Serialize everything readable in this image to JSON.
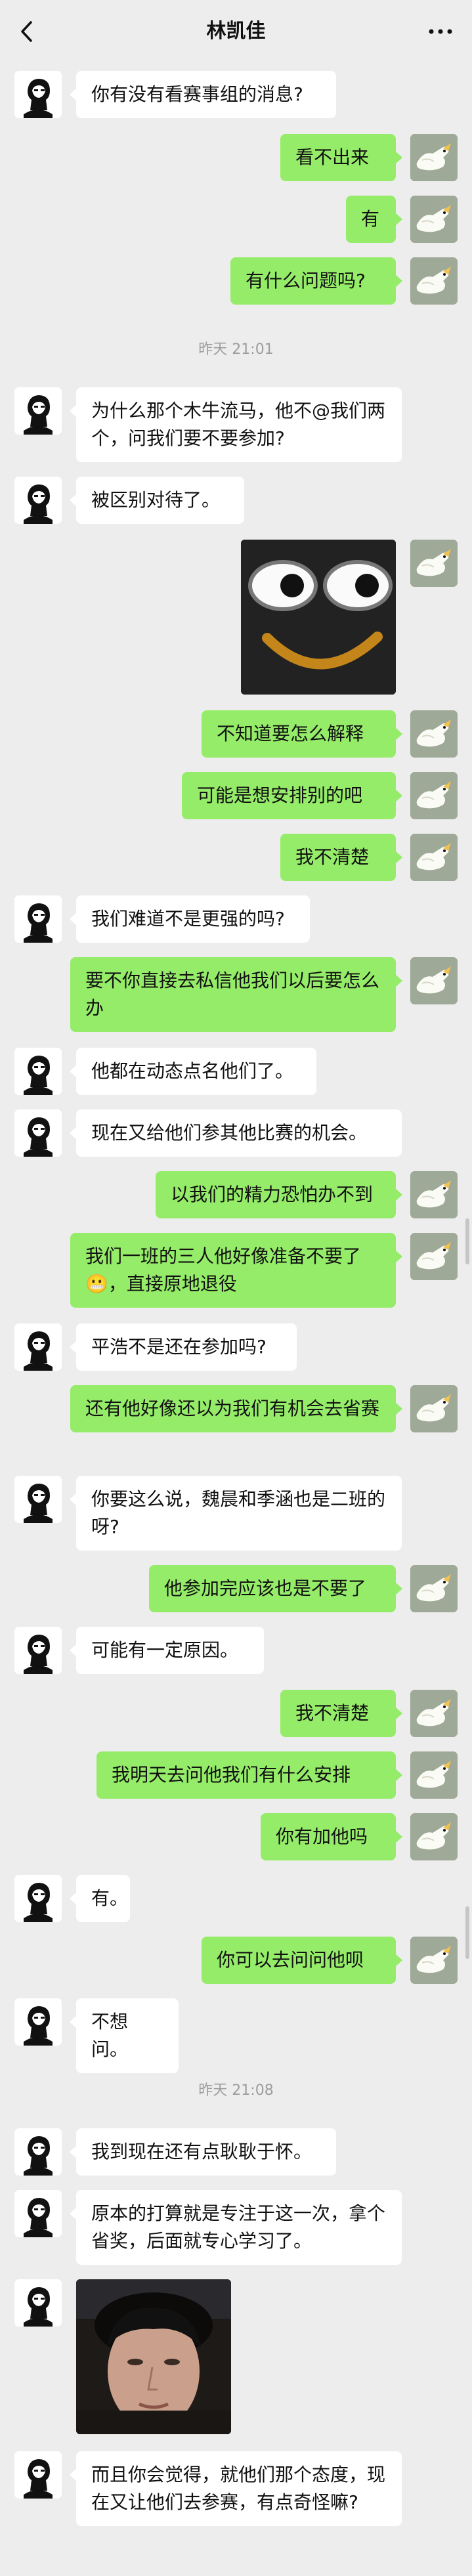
{
  "header": {
    "title": "林凯佳",
    "back_icon": "chevron-left-icon",
    "more_icon": "more-horizontal-icon"
  },
  "timestamps": [
    "昨天 21:01",
    "昨天 21:08"
  ],
  "messages": [
    {
      "side": "left",
      "text": "你有没有看赛事组的消息?"
    },
    {
      "side": "right",
      "text": "看不出来"
    },
    {
      "side": "right",
      "text": "有"
    },
    {
      "side": "right",
      "text": "有什么问题吗?"
    },
    {
      "side": "left",
      "text": "为什么那个木牛流马，他不@我们两个，问我们要不要参加?"
    },
    {
      "side": "left",
      "text": "被区别对待了。"
    },
    {
      "side": "right",
      "text": "不知道要怎么解释"
    },
    {
      "side": "right",
      "text": "可能是想安排别的吧"
    },
    {
      "side": "right",
      "text": "我不清楚"
    },
    {
      "side": "left",
      "text": "我们难道不是更强的吗?"
    },
    {
      "side": "right",
      "text": "要不你直接去私信他我们以后要怎么办"
    },
    {
      "side": "left",
      "text": "他都在动态点名他们了。"
    },
    {
      "side": "left",
      "text": "现在又给他们参其他比赛的机会。"
    },
    {
      "side": "right",
      "text": "以我们的精力恐怕办不到"
    },
    {
      "side": "right",
      "text": "我们一班的三人他好像准备不要了😬，直接原地退役"
    },
    {
      "side": "left",
      "text": "平浩不是还在参加吗?"
    },
    {
      "side": "right",
      "text": "还有他好像还以为我们有机会去省赛"
    },
    {
      "side": "left",
      "text": "你要这么说，魏晨和季涵也是二班的呀?"
    },
    {
      "side": "right",
      "text": "他参加完应该也是不要了"
    },
    {
      "side": "left",
      "text": "可能有一定原因。"
    },
    {
      "side": "right",
      "text": "我不清楚"
    },
    {
      "side": "right",
      "text": "我明天去问他我们有什么安排"
    },
    {
      "side": "right",
      "text": "你有加他吗"
    },
    {
      "side": "left",
      "text": "有。"
    },
    {
      "side": "right",
      "text": "你可以去问问他呗"
    },
    {
      "side": "left",
      "text": "不想问。"
    },
    {
      "side": "left",
      "text": "我到现在还有点耿耿于怀。"
    },
    {
      "side": "left",
      "text": "原本的打算就是专注于这一次，拿个省奖，后面就专心学习了。"
    },
    {
      "side": "left",
      "text": "而且你会觉得，就他们那个态度，现在又让他们去参赛，有点奇怪嘛?"
    }
  ],
  "colors": {
    "background": "#ededed",
    "my_bubble": "#95ec69",
    "their_bubble": "#ffffff"
  }
}
